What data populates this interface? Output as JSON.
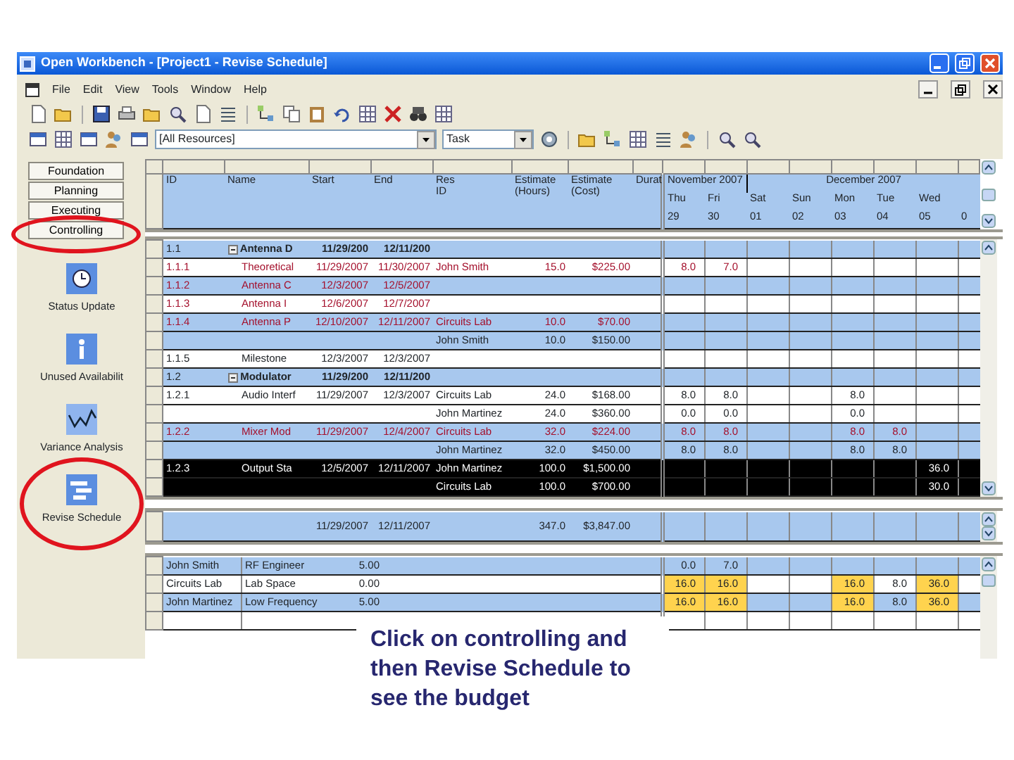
{
  "window": {
    "title": "Open Workbench - [Project1 - Revise Schedule]"
  },
  "menu": [
    "File",
    "Edit",
    "View",
    "Tools",
    "Window",
    "Help"
  ],
  "filters": {
    "resource": "[All Resources]",
    "view": "Task"
  },
  "phases": [
    {
      "label": "Foundation",
      "circled": false
    },
    {
      "label": "Planning",
      "circled": false
    },
    {
      "label": "Executing",
      "circled": false
    },
    {
      "label": "Controlling",
      "circled": true
    }
  ],
  "tools": [
    {
      "label": "Status Update",
      "kind": "status",
      "circled": false
    },
    {
      "label": "Unused Availabilit",
      "kind": "availability",
      "circled": false
    },
    {
      "label": "Variance Analysis",
      "kind": "variance",
      "circled": false
    },
    {
      "label": "Revise Schedule",
      "kind": "revise",
      "circled": true
    }
  ],
  "task_table": {
    "columns": [
      "ID",
      "Name",
      "Start",
      "End",
      "Res ID",
      "Estimate (Hours)",
      "Estimate (Cost)",
      "Durat"
    ],
    "rows": [
      {
        "id": "1.1",
        "name": "Antenna D",
        "start": "11/29/200",
        "end": "12/11/200",
        "kind": "summary",
        "critical": false,
        "shaded": true,
        "selected": false
      },
      {
        "id": "1.1.1",
        "name": "Theoretical",
        "start": "11/29/2007",
        "end": "11/30/2007",
        "res_id": "John Smith",
        "hours": "15.0",
        "cost": "$225.00",
        "kind": "task",
        "critical": true,
        "shaded": false,
        "selected": false,
        "gantt": {
          "thu": "8.0",
          "fri": "7.0"
        }
      },
      {
        "id": "1.1.2",
        "name": "Antenna C",
        "start": "12/3/2007",
        "end": "12/5/2007",
        "kind": "task",
        "critical": true,
        "shaded": true,
        "selected": false
      },
      {
        "id": "1.1.3",
        "name": "Antenna I",
        "start": "12/6/2007",
        "end": "12/7/2007",
        "kind": "task",
        "critical": true,
        "shaded": false,
        "selected": false
      },
      {
        "id": "1.1.4",
        "name": "Antenna P",
        "start": "12/10/2007",
        "end": "12/11/2007",
        "res_id": "Circuits Lab",
        "hours": "10.0",
        "cost": "$70.00",
        "kind": "task",
        "critical": true,
        "shaded": true,
        "selected": false
      },
      {
        "res_id": "John Smith",
        "hours": "10.0",
        "cost": "$150.00",
        "kind": "assignment",
        "critical": false,
        "shaded": true,
        "selected": false
      },
      {
        "id": "1.1.5",
        "name": "Milestone",
        "start": "12/3/2007",
        "end": "12/3/2007",
        "kind": "task",
        "critical": false,
        "shaded": false,
        "selected": false
      },
      {
        "id": "1.2",
        "name": "Modulator",
        "start": "11/29/200",
        "end": "12/11/200",
        "kind": "summary",
        "critical": false,
        "shaded": true,
        "selected": false
      },
      {
        "id": "1.2.1",
        "name": "Audio Interf",
        "start": "11/29/2007",
        "end": "12/3/2007",
        "res_id": "Circuits Lab",
        "hours": "24.0",
        "cost": "$168.00",
        "kind": "task",
        "critical": false,
        "shaded": false,
        "selected": false,
        "gantt": {
          "thu": "8.0",
          "fri": "8.0",
          "mon": "8.0"
        }
      },
      {
        "res_id": "John Martinez",
        "hours": "24.0",
        "cost": "$360.00",
        "kind": "assignment",
        "critical": false,
        "shaded": false,
        "selected": false,
        "gantt": {
          "thu": "0.0",
          "fri": "0.0",
          "mon": "0.0"
        }
      },
      {
        "id": "1.2.2",
        "name": "Mixer Mod",
        "start": "11/29/2007",
        "end": "12/4/2007",
        "res_id": "Circuits Lab",
        "hours": "32.0",
        "cost": "$224.00",
        "kind": "task",
        "critical": true,
        "shaded": true,
        "selected": false,
        "gantt": {
          "thu": "8.0",
          "fri": "8.0",
          "mon": "8.0",
          "tue": "8.0"
        }
      },
      {
        "res_id": "John Martinez",
        "hours": "32.0",
        "cost": "$450.00",
        "kind": "assignment",
        "critical": false,
        "shaded": true,
        "selected": false,
        "gantt": {
          "thu": "8.0",
          "fri": "8.0",
          "mon": "8.0",
          "tue": "8.0"
        }
      },
      {
        "id": "1.2.3",
        "name": "Output Sta",
        "start": "12/5/2007",
        "end": "12/11/2007",
        "res_id": "John Martinez",
        "hours": "100.0",
        "cost": "$1,500.00",
        "kind": "task",
        "critical": false,
        "selected": true,
        "gantt": {
          "wed": "36.0"
        }
      },
      {
        "res_id": "Circuits Lab",
        "hours": "100.0",
        "cost": "$700.00",
        "kind": "assignment",
        "critical": false,
        "selected": true,
        "gantt": {
          "wed": "30.0"
        }
      }
    ]
  },
  "timescale": [
    {
      "month": "November 2007",
      "days": [
        {
          "day": "Thu",
          "date": "29"
        },
        {
          "day": "Fri",
          "date": "30"
        }
      ]
    },
    {
      "month": "December 2007",
      "days": [
        {
          "day": "Sat",
          "date": "01"
        },
        {
          "day": "Sun",
          "date": "02"
        },
        {
          "day": "Mon",
          "date": "03"
        },
        {
          "day": "Tue",
          "date": "04"
        },
        {
          "day": "Wed",
          "date": "05"
        },
        {
          "date": "0"
        }
      ]
    }
  ],
  "totals": {
    "start": "11/29/2007",
    "end": "12/11/2007",
    "hours": "347.0",
    "cost": "$3,847.00"
  },
  "resources": [
    {
      "name": "John Smith",
      "role": "RF Engineer",
      "rate": "5.00",
      "shaded": true,
      "gantt": {
        "thu": {
          "value": "0.0",
          "over": false
        },
        "fri": {
          "value": "7.0",
          "over": false
        }
      }
    },
    {
      "name": "Circuits Lab",
      "role": "Lab Space",
      "rate": "0.00",
      "shaded": false,
      "gantt": {
        "thu": {
          "value": "16.0",
          "over": true
        },
        "fri": {
          "value": "16.0",
          "over": true
        },
        "mon": {
          "value": "16.0",
          "over": true
        },
        "tue": {
          "value": "8.0",
          "over": false
        },
        "wed": {
          "value": "36.0",
          "over": true
        }
      }
    },
    {
      "name": "John Martinez",
      "role": "Low Frequency",
      "rate": "5.00",
      "shaded": true,
      "gantt": {
        "thu": {
          "value": "16.0",
          "over": true
        },
        "fri": {
          "value": "16.0",
          "over": true
        },
        "mon": {
          "value": "16.0",
          "over": true
        },
        "tue": {
          "value": "8.0",
          "over": false
        },
        "wed": {
          "value": "36.0",
          "over": true
        }
      }
    }
  ],
  "caption": "Click on controlling and then Revise Schedule to see the budget"
}
